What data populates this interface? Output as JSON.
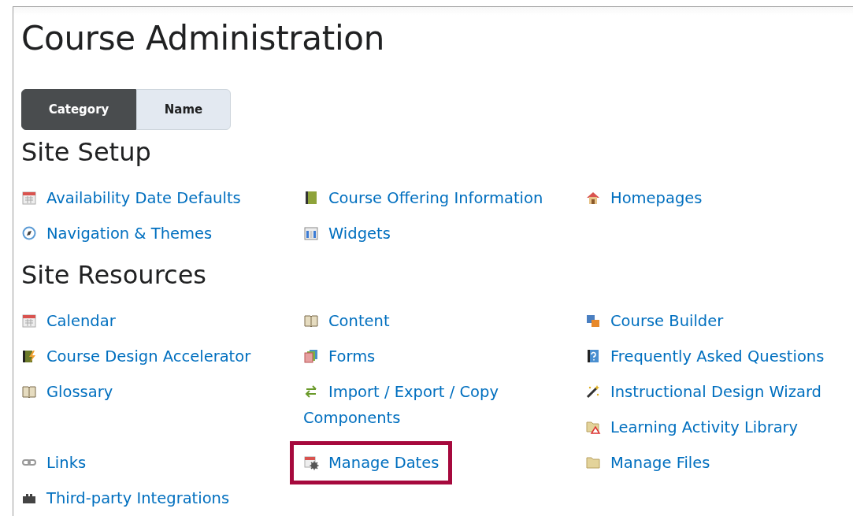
{
  "title": "Course Administration",
  "view_toggle": [
    {
      "label": "Category",
      "selected": true
    },
    {
      "label": "Name",
      "selected": false
    }
  ],
  "sections": [
    {
      "heading": "Site Setup",
      "items": [
        {
          "label": "Availability Date Defaults",
          "kind": "calendar",
          "highlighted": false
        },
        {
          "label": "Course Offering Information",
          "kind": "book",
          "highlighted": false
        },
        {
          "label": "Homepages",
          "kind": "house",
          "highlighted": false
        },
        {
          "label": "Navigation & Themes",
          "kind": "compass",
          "highlighted": false
        },
        {
          "label": "Widgets",
          "kind": "widgets",
          "highlighted": false
        }
      ]
    },
    {
      "heading": "Site Resources",
      "items": [
        {
          "label": "Calendar",
          "kind": "calendar",
          "highlighted": false
        },
        {
          "label": "Content",
          "kind": "open-book",
          "highlighted": false
        },
        {
          "label": "Course Builder",
          "kind": "cubes",
          "highlighted": false
        },
        {
          "label": "Course Design Accelerator",
          "kind": "bolt-book",
          "highlighted": false
        },
        {
          "label": "Forms",
          "kind": "forms",
          "highlighted": false
        },
        {
          "label": "Frequently Asked Questions",
          "kind": "question-book",
          "highlighted": false
        },
        {
          "label": "Glossary",
          "kind": "open-book",
          "highlighted": false
        },
        {
          "label": "Import / Export / Copy Components",
          "kind": "arrows",
          "highlighted": false
        },
        {
          "label": "Instructional Design Wizard",
          "kind": "wand",
          "highlighted": false
        },
        {
          "label": "Learning Activity Library",
          "kind": "folder-triangle",
          "highlighted": false
        },
        {
          "label": "Links",
          "kind": "chain",
          "highlighted": false
        },
        {
          "label": "Manage Dates",
          "kind": "calendar-gear",
          "highlighted": true
        },
        {
          "label": "Manage Files",
          "kind": "folder",
          "highlighted": false
        },
        {
          "label": "Third-party Integrations",
          "kind": "puzzle",
          "highlighted": false
        }
      ]
    }
  ]
}
